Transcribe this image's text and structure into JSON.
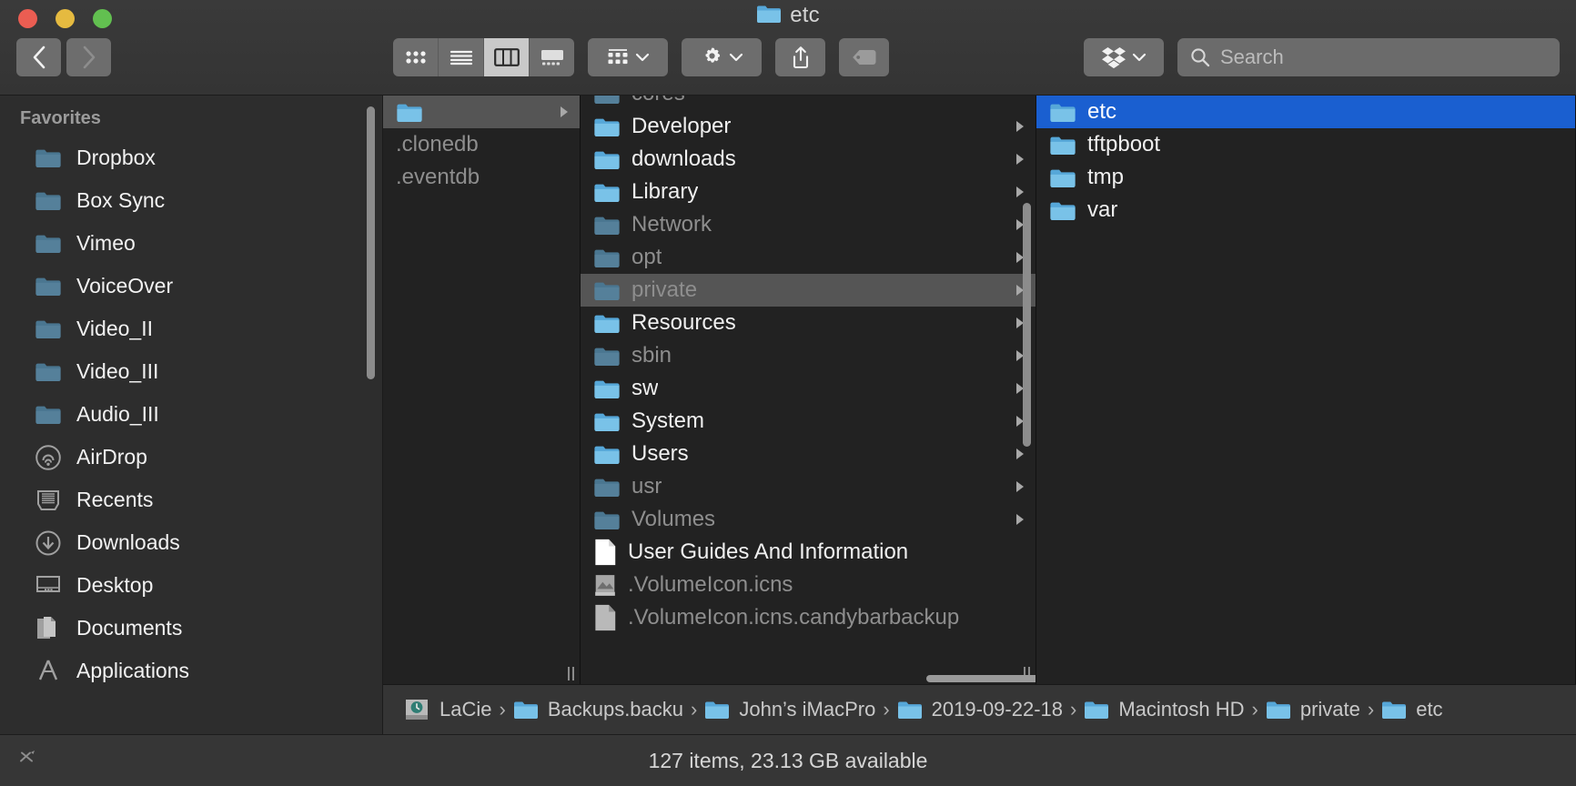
{
  "window": {
    "title": "etc",
    "title_icon": "folder-icon",
    "traffic_lights": [
      {
        "name": "close-button",
        "color": "#eb5d52"
      },
      {
        "name": "minimize-button",
        "color": "#e5ba40"
      },
      {
        "name": "zoom-button",
        "color": "#62c050"
      }
    ]
  },
  "toolbar": {
    "back_label": "Back",
    "forward_label": "Forward",
    "view_modes": [
      {
        "name": "icon-view",
        "label": "Icon View",
        "active": false
      },
      {
        "name": "list-view",
        "label": "List View",
        "active": false
      },
      {
        "name": "column-view",
        "label": "Column View",
        "active": true
      },
      {
        "name": "gallery-view",
        "label": "Gallery View",
        "active": false
      }
    ],
    "group_label": "Group",
    "action_label": "Action",
    "share_label": "Share",
    "tags_label": "Tags",
    "dropbox_label": "Dropbox"
  },
  "search": {
    "placeholder": "Search",
    "value": ""
  },
  "sidebar": {
    "section_title": "Favorites",
    "items": [
      {
        "label": "Dropbox",
        "icon": "folder-icon"
      },
      {
        "label": "Box Sync",
        "icon": "folder-icon"
      },
      {
        "label": "Vimeo",
        "icon": "folder-icon"
      },
      {
        "label": "VoiceOver",
        "icon": "folder-icon"
      },
      {
        "label": "Video_II",
        "icon": "folder-icon"
      },
      {
        "label": "Video_III",
        "icon": "folder-icon"
      },
      {
        "label": "Audio_III",
        "icon": "folder-icon"
      },
      {
        "label": "AirDrop",
        "icon": "airdrop-icon"
      },
      {
        "label": "Recents",
        "icon": "recents-icon"
      },
      {
        "label": "Downloads",
        "icon": "downloads-icon"
      },
      {
        "label": "Desktop",
        "icon": "desktop-icon"
      },
      {
        "label": "Documents",
        "icon": "documents-icon"
      },
      {
        "label": "Applications",
        "icon": "applications-icon"
      }
    ]
  },
  "columns": {
    "col2": {
      "items": [
        {
          "label": "",
          "kind": "folder",
          "dim": false,
          "selected": true,
          "has_chevron": true,
          "partial": true
        },
        {
          "label": ".clonedb",
          "kind": "none",
          "dim": true,
          "selected": false,
          "has_chevron": false
        },
        {
          "label": ".eventdb",
          "kind": "none",
          "dim": true,
          "selected": false,
          "has_chevron": false
        }
      ]
    },
    "col3": {
      "items": [
        {
          "label": "cores",
          "kind": "folder",
          "dim": true,
          "selected": false,
          "has_chevron": false,
          "partial": true
        },
        {
          "label": "Developer",
          "kind": "folder",
          "dim": false,
          "selected": false,
          "has_chevron": true
        },
        {
          "label": "downloads",
          "kind": "folder",
          "dim": false,
          "selected": false,
          "has_chevron": true
        },
        {
          "label": "Library",
          "kind": "folder",
          "dim": false,
          "selected": false,
          "has_chevron": true
        },
        {
          "label": "Network",
          "kind": "folder",
          "dim": true,
          "selected": false,
          "has_chevron": true
        },
        {
          "label": "opt",
          "kind": "folder",
          "dim": true,
          "selected": false,
          "has_chevron": true
        },
        {
          "label": "private",
          "kind": "folder",
          "dim": true,
          "selected": true,
          "has_chevron": true
        },
        {
          "label": "Resources",
          "kind": "folder",
          "dim": false,
          "selected": false,
          "has_chevron": true
        },
        {
          "label": "sbin",
          "kind": "folder",
          "dim": true,
          "selected": false,
          "has_chevron": true
        },
        {
          "label": "sw",
          "kind": "folder",
          "dim": false,
          "selected": false,
          "has_chevron": true
        },
        {
          "label": "System",
          "kind": "folder",
          "dim": false,
          "selected": false,
          "has_chevron": true
        },
        {
          "label": "Users",
          "kind": "folder",
          "dim": false,
          "selected": false,
          "has_chevron": true
        },
        {
          "label": "usr",
          "kind": "folder",
          "dim": true,
          "selected": false,
          "has_chevron": true
        },
        {
          "label": "Volumes",
          "kind": "folder",
          "dim": true,
          "selected": false,
          "has_chevron": true
        },
        {
          "label": "User Guides And Information",
          "kind": "document",
          "dim": false,
          "selected": false,
          "has_chevron": false
        },
        {
          "label": ".VolumeIcon.icns",
          "kind": "image",
          "dim": true,
          "selected": false,
          "has_chevron": false
        },
        {
          "label": ".VolumeIcon.icns.candybarbackup",
          "kind": "document",
          "dim": true,
          "selected": false,
          "has_chevron": false
        }
      ]
    },
    "col4": {
      "items": [
        {
          "label": "etc",
          "kind": "folder",
          "dim": false,
          "selected": true,
          "has_chevron": false
        },
        {
          "label": "tftpboot",
          "kind": "folder",
          "dim": false,
          "selected": false,
          "has_chevron": false
        },
        {
          "label": "tmp",
          "kind": "folder",
          "dim": false,
          "selected": false,
          "has_chevron": false
        },
        {
          "label": "var",
          "kind": "folder",
          "dim": false,
          "selected": false,
          "has_chevron": false
        }
      ]
    }
  },
  "pathbar": {
    "separator": "›",
    "crumbs": [
      {
        "label": "LaCie",
        "icon": "time-machine-disk-icon"
      },
      {
        "label": "Backups.backu",
        "icon": "folder-icon"
      },
      {
        "label": "John’s iMacPro",
        "icon": "folder-icon"
      },
      {
        "label": "2019-09-22-18",
        "icon": "folder-icon"
      },
      {
        "label": "Macintosh HD",
        "icon": "folder-icon"
      },
      {
        "label": "private",
        "icon": "folder-icon"
      },
      {
        "label": "etc",
        "icon": "folder-icon"
      }
    ]
  },
  "statusbar": {
    "text": "127 items, 23.13 GB available"
  },
  "colors": {
    "selection_blue": "#1a5fd0",
    "selection_gray": "#555555",
    "folder_blue": "#6bb8e0",
    "window_bg": "#2a2a2a",
    "column_bg": "#222222"
  }
}
